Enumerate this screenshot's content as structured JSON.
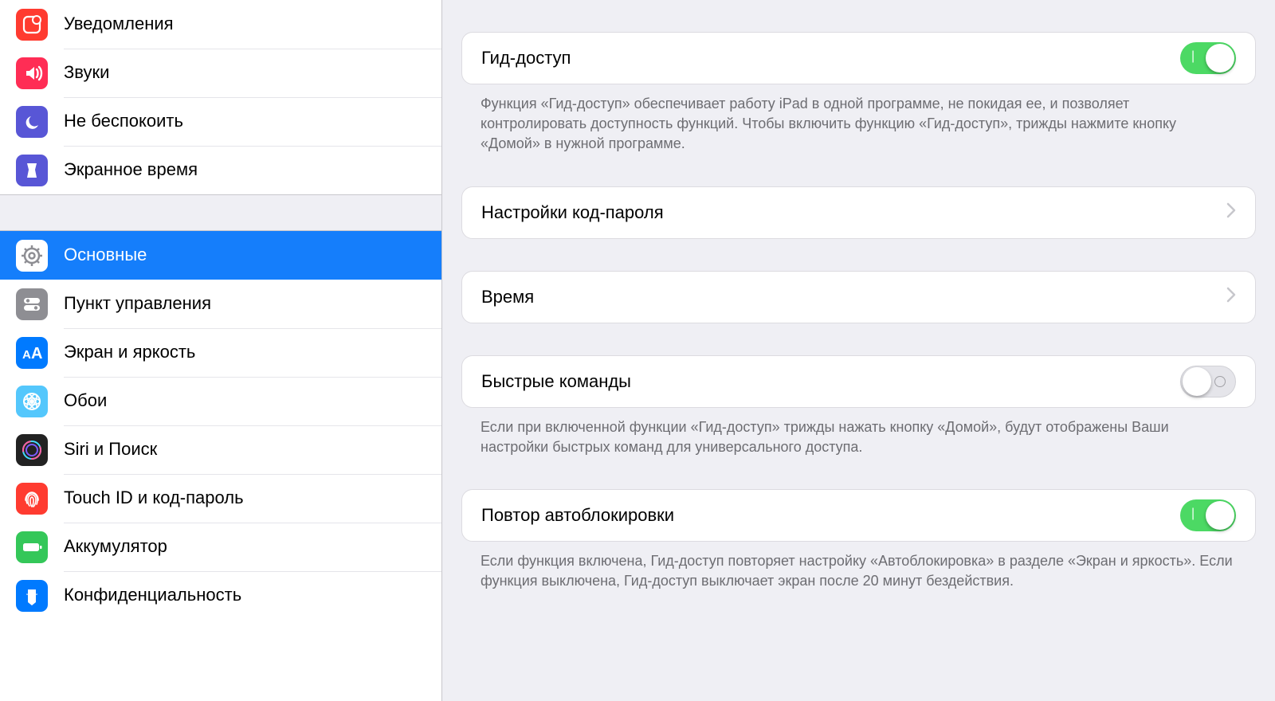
{
  "sidebar": {
    "group1": [
      {
        "id": "notifications",
        "label": "Уведомления",
        "icon": "notif"
      },
      {
        "id": "sounds",
        "label": "Звуки",
        "icon": "sound"
      },
      {
        "id": "dnd",
        "label": "Не беспокоить",
        "icon": "dnd"
      },
      {
        "id": "screentime",
        "label": "Экранное время",
        "icon": "screentime"
      }
    ],
    "group2": [
      {
        "id": "general",
        "label": "Основные",
        "icon": "general",
        "selected": true
      },
      {
        "id": "controlcenter",
        "label": "Пункт управления",
        "icon": "control"
      },
      {
        "id": "display",
        "label": "Экран и яркость",
        "icon": "display"
      },
      {
        "id": "wallpaper",
        "label": "Обои",
        "icon": "wallpaper"
      },
      {
        "id": "siri",
        "label": "Siri и Поиск",
        "icon": "siri"
      },
      {
        "id": "touchid",
        "label": "Touch ID и код-пароль",
        "icon": "touchid"
      },
      {
        "id": "battery",
        "label": "Аккумулятор",
        "icon": "battery"
      },
      {
        "id": "privacy",
        "label": "Конфиденциальность",
        "icon": "privacy"
      }
    ]
  },
  "detail": {
    "guided_access": {
      "label": "Гид-доступ",
      "enabled": true
    },
    "guided_access_desc": "Функция «Гид-доступ» обеспечивает работу iPad в одной программе, не покидая ее, и позволяет контролировать доступность функций. Чтобы включить функцию «Гид-доступ», трижды нажмите кнопку «Домой» в нужной программе.",
    "passcode_settings": {
      "label": "Настройки код-пароля"
    },
    "time_limits": {
      "label": "Время"
    },
    "shortcut": {
      "label": "Быстрые команды",
      "enabled": false
    },
    "shortcut_desc": "Если при включенной функции «Гид-доступ» трижды нажать кнопку «Домой», будут отображены Ваши настройки быстрых команд для универсального доступа.",
    "mirror_autolock": {
      "label": "Повтор автоблокировки",
      "enabled": true
    },
    "mirror_autolock_desc": "Если функция включена, Гид-доступ повторяет настройку «Автоблокировка» в разделе «Экран и яркость». Если функция выключена, Гид-доступ выключает экран после 20 минут бездействия."
  }
}
